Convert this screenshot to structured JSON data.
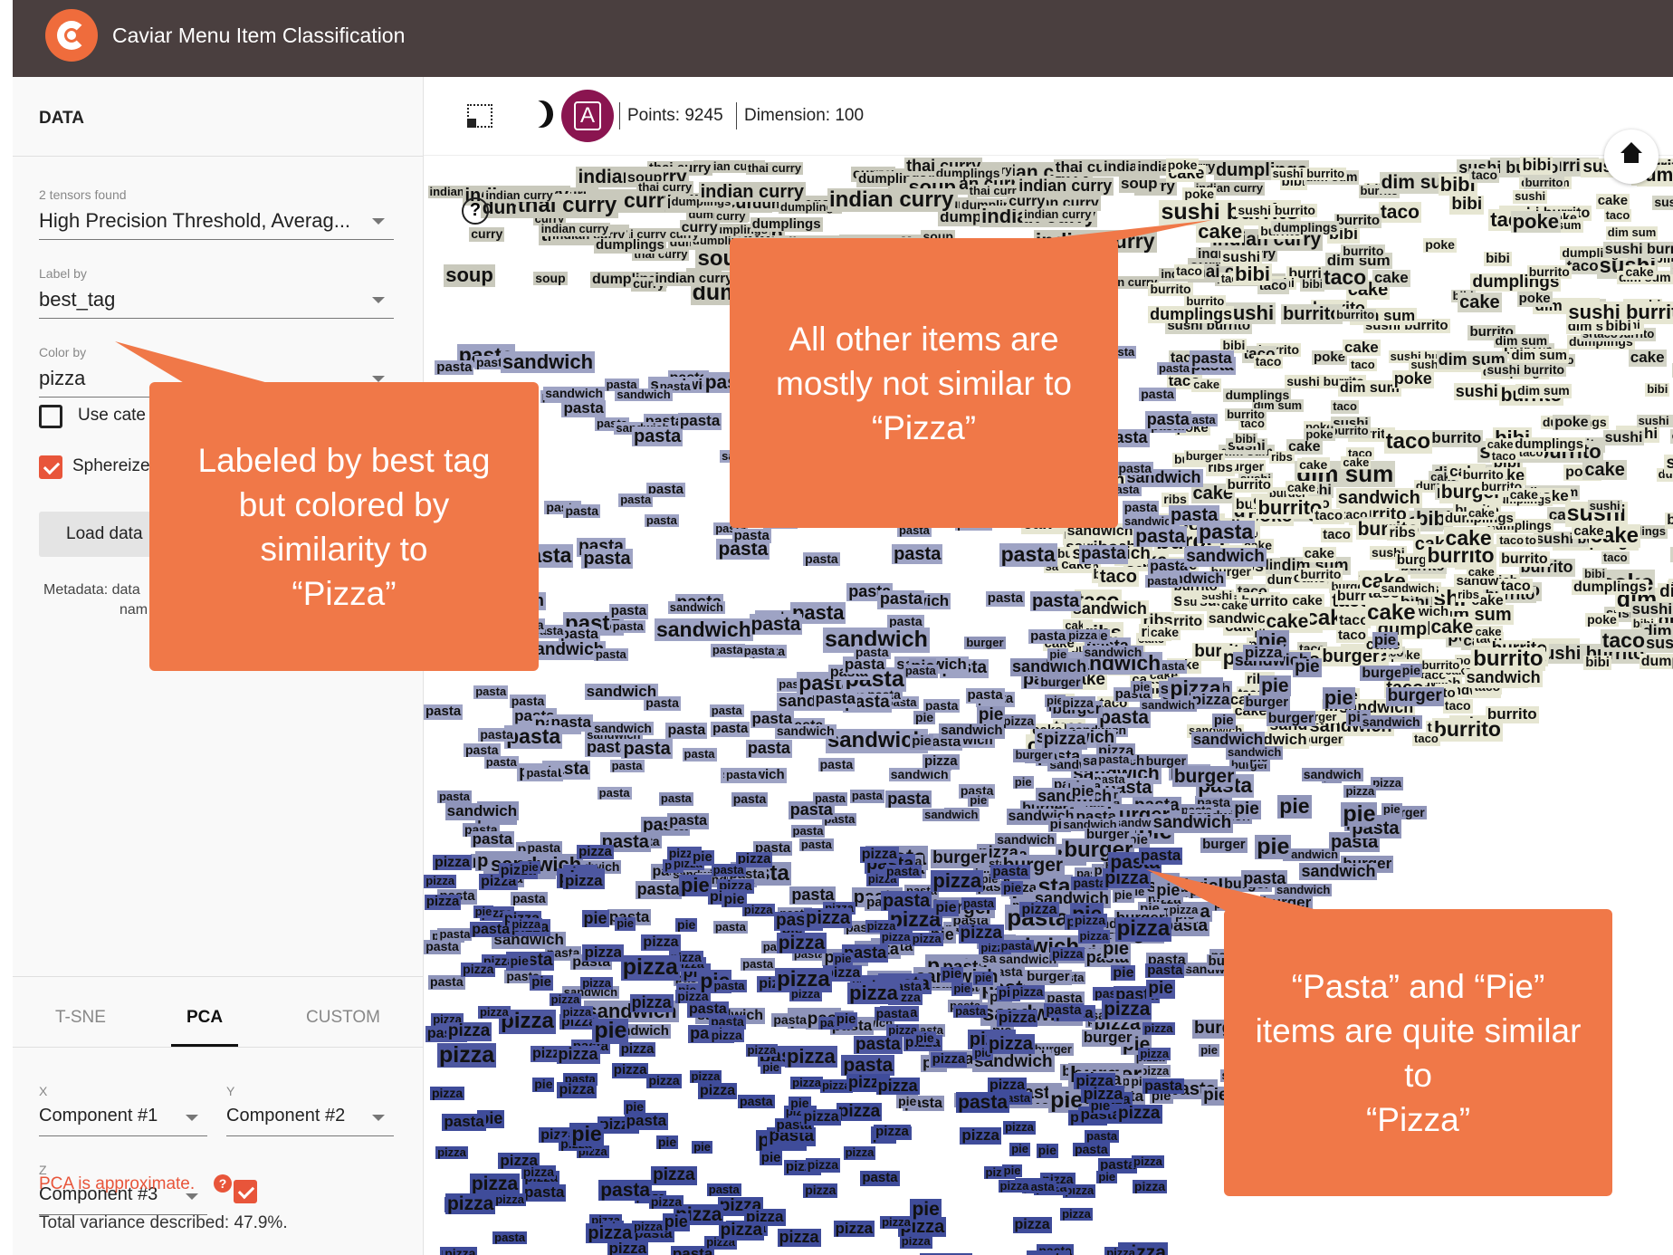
{
  "app": {
    "title": "Caviar Menu Item Classification",
    "logo_icon": "caviar-logo"
  },
  "sidebar": {
    "section_title": "DATA",
    "tensors": {
      "label": "2 tensors found",
      "value": "High Precision Threshold, Averag..."
    },
    "label_by": {
      "label": "Label by",
      "value": "best_tag"
    },
    "color_by": {
      "label": "Color by",
      "value": "pizza"
    },
    "use_categorical": {
      "label": "Use cate",
      "checked": false
    },
    "sphereize": {
      "label": "Sphereize",
      "checked": true
    },
    "load_button": "Load data",
    "metadata_line1": "Metadata: data",
    "metadata_line2": "nam",
    "tabs": [
      {
        "label": "T-SNE",
        "active": false
      },
      {
        "label": "PCA",
        "active": true
      },
      {
        "label": "CUSTOM",
        "active": false
      }
    ],
    "x": {
      "label": "X",
      "value": "Component #1"
    },
    "y": {
      "label": "Y",
      "value": "Component #2"
    },
    "z": {
      "label": "Z",
      "value": "Component #3",
      "checked": true
    },
    "pca_warning": "PCA is approximate.",
    "variance": "Total variance described: 47.9%."
  },
  "toolbar": {
    "points": "Points: 9245",
    "dimension": "Dimension: 100",
    "avatar_letter": "A"
  },
  "canvas": {
    "help": "?",
    "colors": {
      "dissimilar": "#e6e6d2",
      "curry": "#c9c9bc",
      "pasta": "#9ea3c4",
      "pie": "#9095b9",
      "pizza": "#4d57a0",
      "accent": "#f07848"
    },
    "clusters": [
      {
        "color_key": "curry",
        "words": [
          "indian curry",
          "thai curry",
          "indian curry",
          "curry",
          "soup",
          "dumplings"
        ]
      },
      {
        "color_key": "dissimilar",
        "words": [
          "dumplings",
          "sushi",
          "poke",
          "cake",
          "taco",
          "sushi burrito",
          "burrito",
          "bibi",
          "dim sum"
        ]
      },
      {
        "color_key": "dissimilar",
        "words": [
          "cake",
          "burrito",
          "ribs",
          "sandwich",
          "taco",
          "burger",
          "cake"
        ]
      },
      {
        "color_key": "pasta",
        "words": [
          "pasta",
          "pasta",
          "pasta",
          "pasta",
          "sandwich"
        ]
      },
      {
        "color_key": "pie",
        "words": [
          "pie",
          "sandwich",
          "burger",
          "pie",
          "pasta",
          "pizza"
        ]
      },
      {
        "color_key": "pizza",
        "words": [
          "pizza",
          "pizza",
          "pizza",
          "pie",
          "pasta"
        ]
      }
    ]
  },
  "callouts": [
    "Labeled by best tag\nbut colored by\nsimilarity to\n“Pizza”",
    "All other items are\nmostly not similar to\n“Pizza”",
    "“Pasta” and “Pie”\nitems are quite similar\nto\n“Pizza”"
  ]
}
